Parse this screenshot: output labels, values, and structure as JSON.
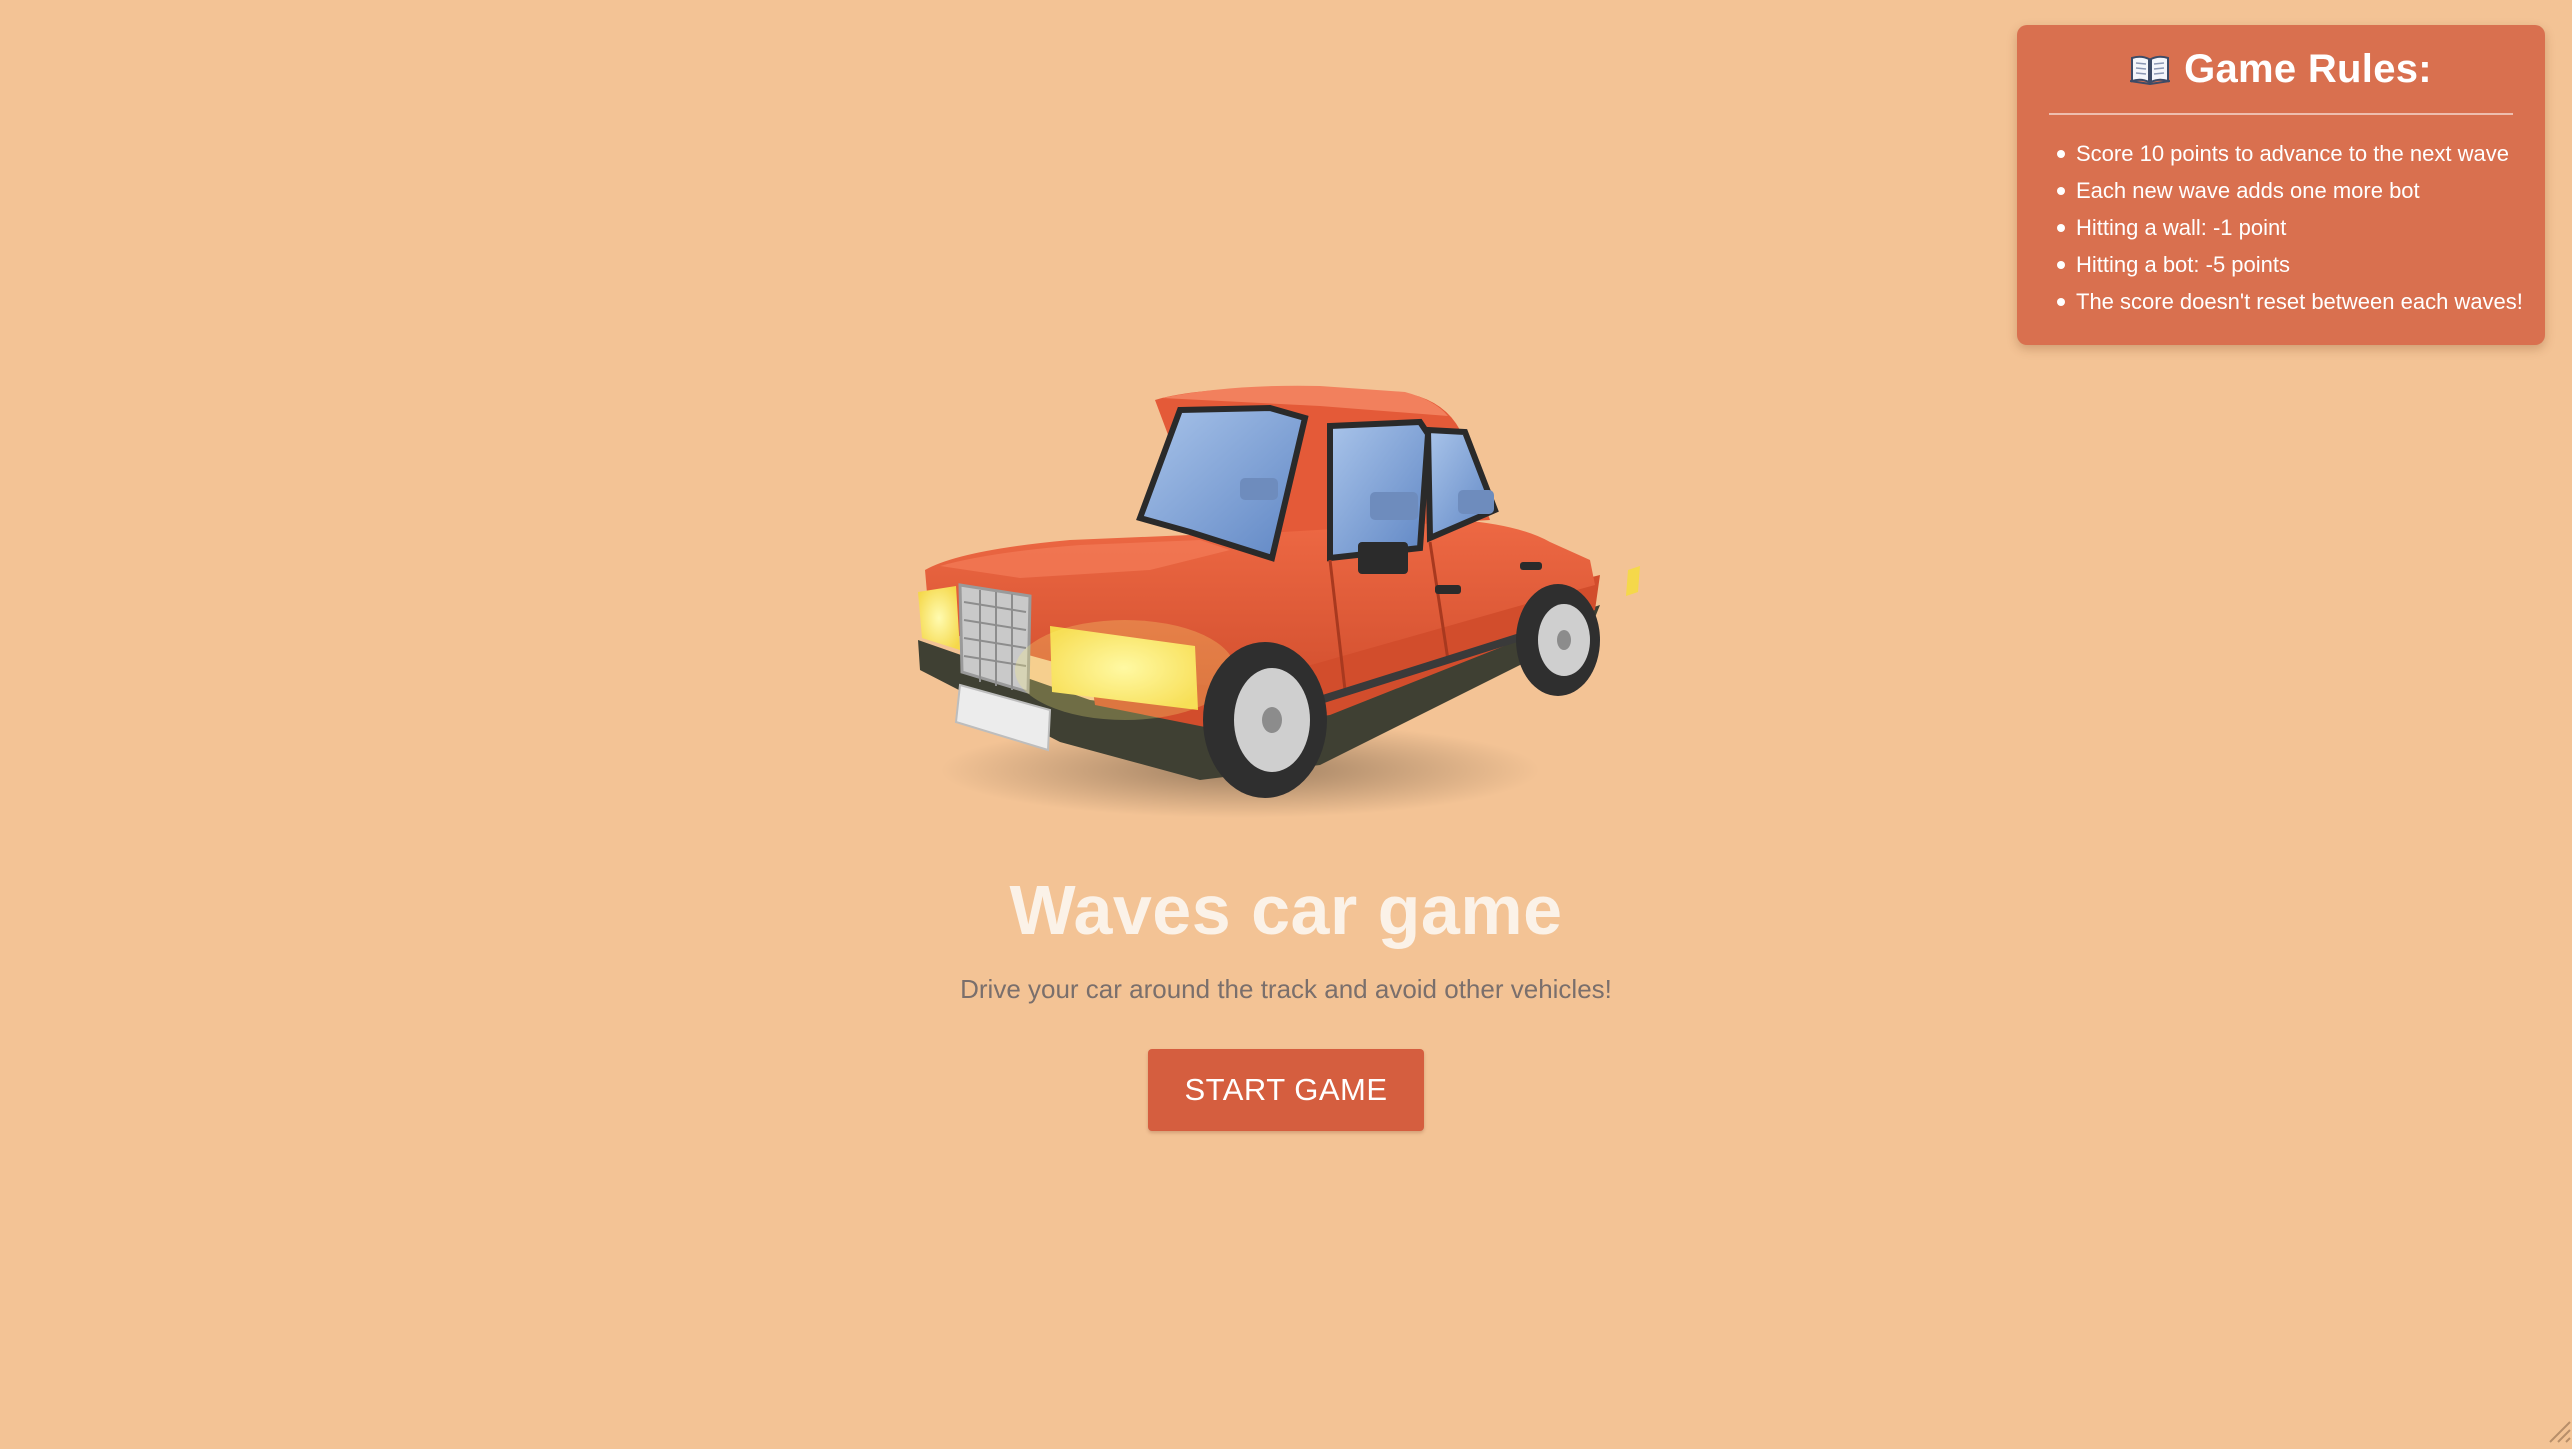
{
  "rules": {
    "icon": "open-book-icon",
    "title": "Game Rules:",
    "items": [
      "Score 10 points to advance to the next wave",
      "Each new wave adds one more bot",
      "Hitting a wall: -1 point",
      "Hitting a bot: -5 points",
      "The score doesn't reset between each waves!"
    ]
  },
  "hero": {
    "image": "orange-sedan-car",
    "title": "Waves car game",
    "subtitle": "Drive your car around the track and avoid other vehicles!"
  },
  "start_button": {
    "label": "START GAME"
  },
  "colors": {
    "background": "#f3c395",
    "panel": "#d9704f",
    "button": "#d55e3f",
    "title": "#fbf2e8",
    "subtitle": "#7a6f6c"
  }
}
